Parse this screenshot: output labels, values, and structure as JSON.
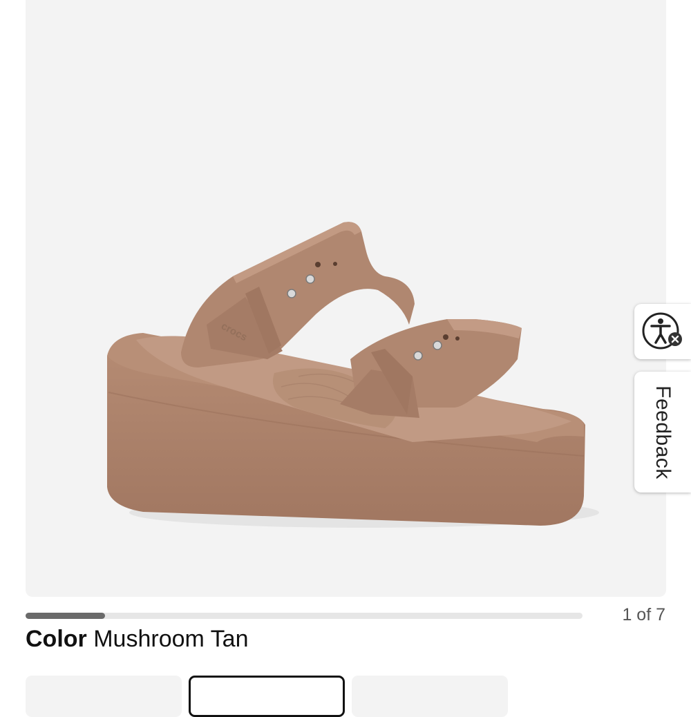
{
  "gallery": {
    "image_alt": "Crocs two-strap wedge sandal",
    "image_icon": "sandal-product-image",
    "background_color": "#f3f3f3",
    "product_color_hex": "#a98068",
    "current_page": 1,
    "total_pages": 7,
    "counter_text": "1 of 7"
  },
  "side_widgets": {
    "accessibility_icon": "accessibility-person-icon",
    "feedback_label": "Feedback"
  },
  "product": {
    "color_label": "Color",
    "color_value": "Mushroom Tan"
  },
  "swatches": {
    "count_visible": 3,
    "selected_index": 1
  }
}
